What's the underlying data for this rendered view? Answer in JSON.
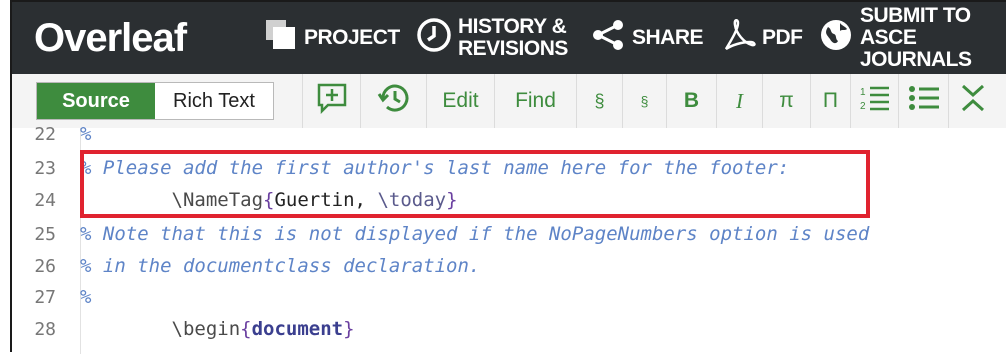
{
  "app": {
    "logo_text": "Overleaf"
  },
  "topbar": {
    "project_label": "PROJECT",
    "history_label_1": "HISTORY &",
    "history_label_2": "REVISIONS",
    "share_label": "SHARE",
    "pdf_label": "PDF",
    "submit_label_1": "SUBMIT TO",
    "submit_label_2": "ASCE JOURNALS"
  },
  "toolbar": {
    "source_label": "Source",
    "richtext_label": "Rich Text",
    "edit_label": "Edit",
    "find_label": "Find",
    "section_label": "§",
    "subsection_label": "§",
    "bold_label": "B",
    "italic_label": "I",
    "pi_label": "π",
    "pi2_label": "Π"
  },
  "editor": {
    "lines": [
      {
        "num": "22",
        "text": "%"
      },
      {
        "num": "23",
        "text": "% Please add the first author's last name here for the footer:"
      },
      {
        "num": "24",
        "cmd": "\\NameTag",
        "open": "{",
        "arg": "Guertin, ",
        "cmd2": "\\today",
        "close": "}"
      },
      {
        "num": "25",
        "text": "% Note that this is not displayed if the NoPageNumbers option is used"
      },
      {
        "num": "26",
        "text": "% in the documentclass declaration."
      },
      {
        "num": "27",
        "text": "%"
      },
      {
        "num": "28",
        "cmd": "\\begin",
        "open": "{",
        "arg": "document",
        "close": "}"
      }
    ]
  },
  "colors": {
    "topbar_bg": "#2b2f32",
    "accent_green": "#3e8c3e",
    "highlight_red": "#e0232f",
    "comment_blue": "#5e84c7"
  }
}
